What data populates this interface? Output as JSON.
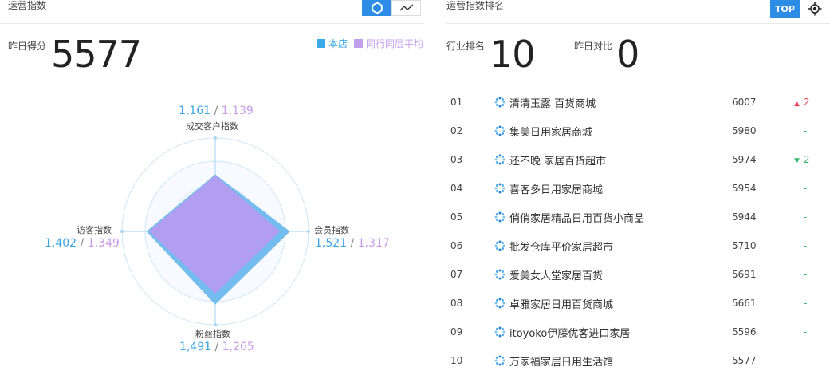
{
  "left_panel": {
    "title": "运营指数",
    "toggle": {
      "radar_icon": "radar-icon",
      "line_icon": "trend-line-icon"
    },
    "score_label": "昨日得分",
    "score_value": "5577",
    "legend": [
      {
        "label": "本店",
        "color": "#39a9ea"
      },
      {
        "label": "同行同层平均",
        "color": "#c3a0ee"
      }
    ],
    "radar": {
      "axes": [
        {
          "name": "成交客户指数",
          "store": "1,161",
          "peer": "1,139",
          "sep": "/"
        },
        {
          "name": "会员指数",
          "store": "1,521",
          "peer": "1,317",
          "sep": "/"
        },
        {
          "name": "粉丝指数",
          "store": "1,491",
          "peer": "1,265",
          "sep": "/"
        },
        {
          "name": "访客指数",
          "store": "1,402",
          "peer": "1,349",
          "sep": "/"
        }
      ],
      "store_color": "#6db8ec",
      "peer_color": "#b49cf0"
    }
  },
  "right_panel": {
    "title": "运营指数排名",
    "top_button": "TOP",
    "target_icon": "crosshair-icon",
    "industry_rank_label": "行业排名",
    "industry_rank_value": "10",
    "compare_label": "昨日对比",
    "compare_value": "0",
    "rows": [
      {
        "num": "01",
        "name": "清清玉露 百货商城",
        "score": "6007",
        "change": "2",
        "dir": "up"
      },
      {
        "num": "02",
        "name": "集美日用家居商城",
        "score": "5980",
        "change": "-",
        "dir": "flat"
      },
      {
        "num": "03",
        "name": "还不晚 家居百货超市",
        "score": "5974",
        "change": "2",
        "dir": "down"
      },
      {
        "num": "04",
        "name": "喜客多日用家居商城",
        "score": "5954",
        "change": "-",
        "dir": "flat"
      },
      {
        "num": "05",
        "name": "俏俏家居精品日用百货小商品",
        "score": "5944",
        "change": "-",
        "dir": "flat"
      },
      {
        "num": "06",
        "name": "批发仓库平价家居超市",
        "score": "5710",
        "change": "-",
        "dir": "flat"
      },
      {
        "num": "07",
        "name": "爱美女人堂家居百货",
        "score": "5691",
        "change": "-",
        "dir": "flat"
      },
      {
        "num": "08",
        "name": "卓雅家居日用百货商城",
        "score": "5661",
        "change": "-",
        "dir": "flat"
      },
      {
        "num": "09",
        "name": "itoyoko伊藤优客进口家居",
        "score": "5596",
        "change": "-",
        "dir": "flat"
      },
      {
        "num": "10",
        "name": "万家福家居日用生活馆",
        "score": "5577",
        "change": "-",
        "dir": "flat"
      }
    ]
  }
}
